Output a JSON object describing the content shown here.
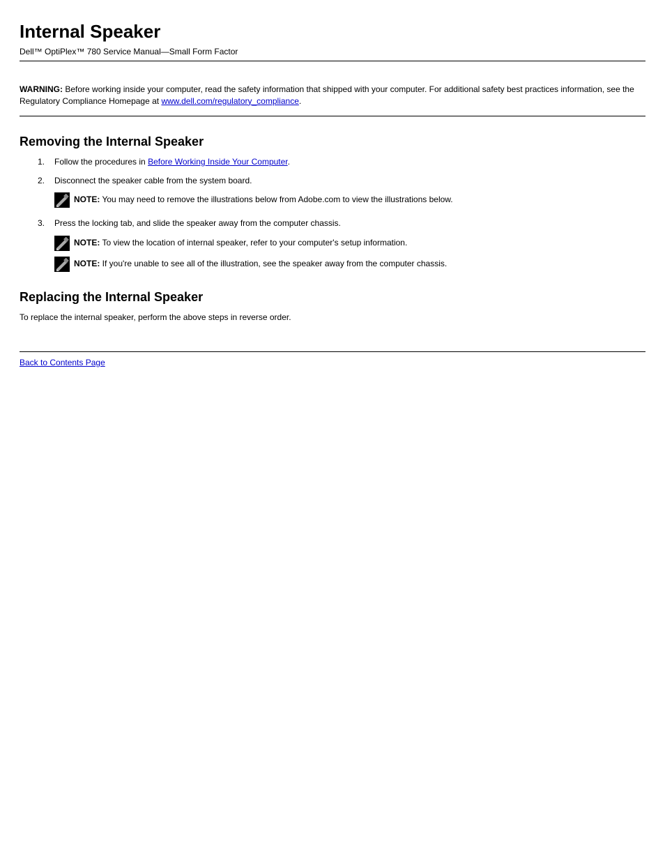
{
  "title": "Internal Speaker",
  "subtitle": "Dell™ OptiPlex™ 780 Service Manual—Small Form Factor",
  "intro": {
    "warning_label": "WARNING:",
    "warning_text": "Before working inside your computer, read the safety information that shipped with your computer. For additional safety best practices information, see the Regulatory Compliance Homepage at ",
    "warning_link": "www.dell.com/regulatory_compliance",
    "warning_tail": "."
  },
  "section_title": "Removing the Internal Speaker",
  "steps": {
    "s1": {
      "num": "1.",
      "text_a": "Follow the procedures in ",
      "link": "Before Working Inside Your Computer",
      "text_b": "."
    },
    "s2": {
      "num": "2.",
      "text": "Disconnect the speaker cable from the system board."
    }
  },
  "notes": {
    "n1": {
      "label": "NOTE:",
      "text": " You may need to remove the illustrations below from Adobe.com to view the illustrations below."
    },
    "n2": {
      "label": "NOTE:",
      "text": " To view the location of internal speaker, refer to your computer's setup information."
    },
    "n3": {
      "label": "NOTE:",
      "text": " If you're unable to see all of the illustration, see the speaker away from the computer chassis."
    }
  },
  "steps2": {
    "s3": {
      "num": "3.",
      "text": "Press the locking tab, and slide the speaker away from the computer chassis."
    }
  },
  "replacing_title": "Replacing the Internal Speaker",
  "replacing_text": "To replace the internal speaker, perform the above steps in reverse order.",
  "back_link": "Back to Contents Page"
}
